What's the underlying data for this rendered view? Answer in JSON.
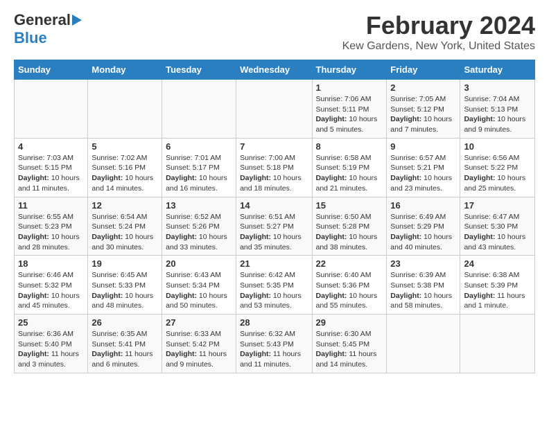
{
  "logo": {
    "line1": "General",
    "line2": "Blue"
  },
  "title": "February 2024",
  "subtitle": "Kew Gardens, New York, United States",
  "days_of_week": [
    "Sunday",
    "Monday",
    "Tuesday",
    "Wednesday",
    "Thursday",
    "Friday",
    "Saturday"
  ],
  "weeks": [
    [
      {
        "day": "",
        "info": ""
      },
      {
        "day": "",
        "info": ""
      },
      {
        "day": "",
        "info": ""
      },
      {
        "day": "",
        "info": ""
      },
      {
        "day": "1",
        "sunrise": "Sunrise: 7:06 AM",
        "sunset": "Sunset: 5:11 PM",
        "daylight": "Daylight: 10 hours and 5 minutes."
      },
      {
        "day": "2",
        "sunrise": "Sunrise: 7:05 AM",
        "sunset": "Sunset: 5:12 PM",
        "daylight": "Daylight: 10 hours and 7 minutes."
      },
      {
        "day": "3",
        "sunrise": "Sunrise: 7:04 AM",
        "sunset": "Sunset: 5:13 PM",
        "daylight": "Daylight: 10 hours and 9 minutes."
      }
    ],
    [
      {
        "day": "4",
        "sunrise": "Sunrise: 7:03 AM",
        "sunset": "Sunset: 5:15 PM",
        "daylight": "Daylight: 10 hours and 11 minutes."
      },
      {
        "day": "5",
        "sunrise": "Sunrise: 7:02 AM",
        "sunset": "Sunset: 5:16 PM",
        "daylight": "Daylight: 10 hours and 14 minutes."
      },
      {
        "day": "6",
        "sunrise": "Sunrise: 7:01 AM",
        "sunset": "Sunset: 5:17 PM",
        "daylight": "Daylight: 10 hours and 16 minutes."
      },
      {
        "day": "7",
        "sunrise": "Sunrise: 7:00 AM",
        "sunset": "Sunset: 5:18 PM",
        "daylight": "Daylight: 10 hours and 18 minutes."
      },
      {
        "day": "8",
        "sunrise": "Sunrise: 6:58 AM",
        "sunset": "Sunset: 5:19 PM",
        "daylight": "Daylight: 10 hours and 21 minutes."
      },
      {
        "day": "9",
        "sunrise": "Sunrise: 6:57 AM",
        "sunset": "Sunset: 5:21 PM",
        "daylight": "Daylight: 10 hours and 23 minutes."
      },
      {
        "day": "10",
        "sunrise": "Sunrise: 6:56 AM",
        "sunset": "Sunset: 5:22 PM",
        "daylight": "Daylight: 10 hours and 25 minutes."
      }
    ],
    [
      {
        "day": "11",
        "sunrise": "Sunrise: 6:55 AM",
        "sunset": "Sunset: 5:23 PM",
        "daylight": "Daylight: 10 hours and 28 minutes."
      },
      {
        "day": "12",
        "sunrise": "Sunrise: 6:54 AM",
        "sunset": "Sunset: 5:24 PM",
        "daylight": "Daylight: 10 hours and 30 minutes."
      },
      {
        "day": "13",
        "sunrise": "Sunrise: 6:52 AM",
        "sunset": "Sunset: 5:26 PM",
        "daylight": "Daylight: 10 hours and 33 minutes."
      },
      {
        "day": "14",
        "sunrise": "Sunrise: 6:51 AM",
        "sunset": "Sunset: 5:27 PM",
        "daylight": "Daylight: 10 hours and 35 minutes."
      },
      {
        "day": "15",
        "sunrise": "Sunrise: 6:50 AM",
        "sunset": "Sunset: 5:28 PM",
        "daylight": "Daylight: 10 hours and 38 minutes."
      },
      {
        "day": "16",
        "sunrise": "Sunrise: 6:49 AM",
        "sunset": "Sunset: 5:29 PM",
        "daylight": "Daylight: 10 hours and 40 minutes."
      },
      {
        "day": "17",
        "sunrise": "Sunrise: 6:47 AM",
        "sunset": "Sunset: 5:30 PM",
        "daylight": "Daylight: 10 hours and 43 minutes."
      }
    ],
    [
      {
        "day": "18",
        "sunrise": "Sunrise: 6:46 AM",
        "sunset": "Sunset: 5:32 PM",
        "daylight": "Daylight: 10 hours and 45 minutes."
      },
      {
        "day": "19",
        "sunrise": "Sunrise: 6:45 AM",
        "sunset": "Sunset: 5:33 PM",
        "daylight": "Daylight: 10 hours and 48 minutes."
      },
      {
        "day": "20",
        "sunrise": "Sunrise: 6:43 AM",
        "sunset": "Sunset: 5:34 PM",
        "daylight": "Daylight: 10 hours and 50 minutes."
      },
      {
        "day": "21",
        "sunrise": "Sunrise: 6:42 AM",
        "sunset": "Sunset: 5:35 PM",
        "daylight": "Daylight: 10 hours and 53 minutes."
      },
      {
        "day": "22",
        "sunrise": "Sunrise: 6:40 AM",
        "sunset": "Sunset: 5:36 PM",
        "daylight": "Daylight: 10 hours and 55 minutes."
      },
      {
        "day": "23",
        "sunrise": "Sunrise: 6:39 AM",
        "sunset": "Sunset: 5:38 PM",
        "daylight": "Daylight: 10 hours and 58 minutes."
      },
      {
        "day": "24",
        "sunrise": "Sunrise: 6:38 AM",
        "sunset": "Sunset: 5:39 PM",
        "daylight": "Daylight: 11 hours and 1 minute."
      }
    ],
    [
      {
        "day": "25",
        "sunrise": "Sunrise: 6:36 AM",
        "sunset": "Sunset: 5:40 PM",
        "daylight": "Daylight: 11 hours and 3 minutes."
      },
      {
        "day": "26",
        "sunrise": "Sunrise: 6:35 AM",
        "sunset": "Sunset: 5:41 PM",
        "daylight": "Daylight: 11 hours and 6 minutes."
      },
      {
        "day": "27",
        "sunrise": "Sunrise: 6:33 AM",
        "sunset": "Sunset: 5:42 PM",
        "daylight": "Daylight: 11 hours and 9 minutes."
      },
      {
        "day": "28",
        "sunrise": "Sunrise: 6:32 AM",
        "sunset": "Sunset: 5:43 PM",
        "daylight": "Daylight: 11 hours and 11 minutes."
      },
      {
        "day": "29",
        "sunrise": "Sunrise: 6:30 AM",
        "sunset": "Sunset: 5:45 PM",
        "daylight": "Daylight: 11 hours and 14 minutes."
      },
      {
        "day": "",
        "info": ""
      },
      {
        "day": "",
        "info": ""
      }
    ]
  ]
}
